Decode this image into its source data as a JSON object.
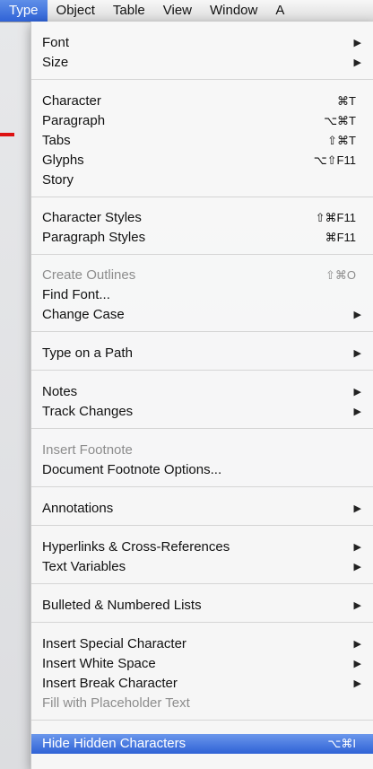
{
  "menubar": {
    "items": [
      "Type",
      "Object",
      "Table",
      "View",
      "Window",
      "A"
    ]
  },
  "menu": {
    "items": [
      {
        "label": "Font",
        "submenu": true
      },
      {
        "label": "Size",
        "submenu": true
      },
      {
        "label": "Character",
        "shortcut": "⌘T"
      },
      {
        "label": "Paragraph",
        "shortcut": "⌥⌘T"
      },
      {
        "label": "Tabs",
        "shortcut": "⇧⌘T"
      },
      {
        "label": "Glyphs",
        "shortcut": "⌥⇧F11"
      },
      {
        "label": "Story"
      },
      {
        "label": "Character Styles",
        "shortcut": "⇧⌘F11"
      },
      {
        "label": "Paragraph Styles",
        "shortcut": "⌘F11"
      },
      {
        "label": "Create Outlines",
        "shortcut": "⇧⌘O",
        "disabled": true
      },
      {
        "label": "Find Font..."
      },
      {
        "label": "Change Case",
        "submenu": true
      },
      {
        "label": "Type on a Path",
        "submenu": true
      },
      {
        "label": "Notes",
        "submenu": true
      },
      {
        "label": "Track Changes",
        "submenu": true
      },
      {
        "label": "Insert Footnote",
        "disabled": true
      },
      {
        "label": "Document Footnote Options..."
      },
      {
        "label": "Annotations",
        "submenu": true
      },
      {
        "label": "Hyperlinks & Cross-References",
        "submenu": true
      },
      {
        "label": "Text Variables",
        "submenu": true
      },
      {
        "label": "Bulleted & Numbered Lists",
        "submenu": true
      },
      {
        "label": "Insert Special Character",
        "submenu": true
      },
      {
        "label": "Insert White Space",
        "submenu": true
      },
      {
        "label": "Insert Break Character",
        "submenu": true
      },
      {
        "label": "Fill with Placeholder Text",
        "disabled": true
      },
      {
        "label": "Hide Hidden Characters",
        "shortcut": "⌥⌘I",
        "highlighted": true
      }
    ]
  },
  "colors": {
    "highlight": "#2f62d6",
    "disabled_text": "#8c8c8c"
  }
}
